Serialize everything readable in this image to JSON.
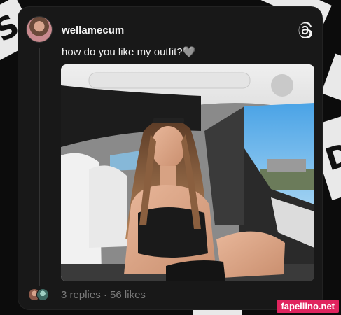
{
  "background": {
    "tiles": [
      "S",
      "",
      "D",
      "",
      ""
    ]
  },
  "post": {
    "username": "wellamecum",
    "text": "how do you like my outfit?🩶",
    "avatar_icon": "user-avatar",
    "app_icon": "threads-logo-icon",
    "replies": "3 replies",
    "separator": "·",
    "likes": "56 likes"
  },
  "watermark": {
    "text": "fapellino.net"
  },
  "colors": {
    "card_bg": "#181818",
    "text_primary": "#f3f3f3",
    "text_secondary": "#7a7a7a",
    "watermark_bg": "#e0245e"
  }
}
